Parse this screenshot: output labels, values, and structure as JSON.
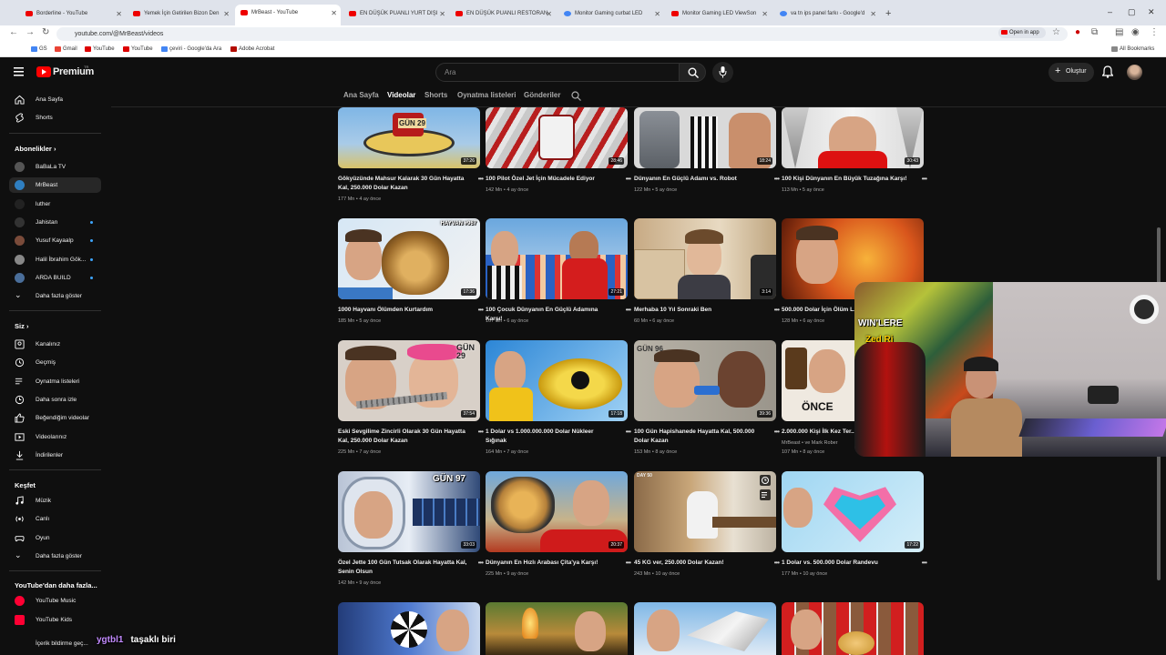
{
  "browser": {
    "tabs": [
      {
        "title": "Borderline - YouTube",
        "icon": "youtube-icon"
      },
      {
        "title": "Yemek İçin Getirilen Bizon Den",
        "icon": "youtube-icon"
      },
      {
        "title": "MrBeast - YouTube",
        "icon": "youtube-icon",
        "active": true
      },
      {
        "title": "EN DÜŞÜK PUANLI YURT DIŞI",
        "icon": "youtube-icon"
      },
      {
        "title": "EN DÜŞÜK PUANLI RESTORAN",
        "icon": "youtube-icon"
      },
      {
        "title": "Monitor Gaming curbat LED ",
        "icon": "google-icon"
      },
      {
        "title": "Monitor Gaming LED ViewSon",
        "icon": "youtube-icon"
      },
      {
        "title": "va tn ips panel farkı - Google'd",
        "icon": "google-icon"
      }
    ],
    "url": "youtube.com/@MrBeast/videos",
    "open_in_app": "Open in app",
    "bookmarks": [
      "Gmail",
      "YouTube",
      "YouTube",
      "çeviri - Google'da Ara",
      "Adobe Acrobat"
    ],
    "all_bookmarks": "All Bookmarks"
  },
  "youtube": {
    "logo": "Premium",
    "logo_sup": "TR",
    "search_placeholder": "Ara",
    "create_label": "Oluştur",
    "channel_tabs": [
      "Ana Sayfa",
      "Videolar",
      "Shorts",
      "Oynatma listeleri",
      "Gönderiler"
    ],
    "active_tab": "Videolar",
    "sidebar": {
      "top": [
        {
          "label": "Ana Sayfa",
          "icon": "home-icon"
        },
        {
          "label": "Shorts",
          "icon": "shorts-icon"
        }
      ],
      "subscriptions_header": "Abonelikler",
      "subscriptions": [
        {
          "label": "BaBaLa TV",
          "dot": false
        },
        {
          "label": "MrBeast",
          "dot": false,
          "active": true
        },
        {
          "label": "luther",
          "dot": false
        },
        {
          "label": "Jahistan",
          "dot": true
        },
        {
          "label": "Yusuf Kayaalp",
          "dot": true
        },
        {
          "label": "Halil İbrahim Gök...",
          "dot": true
        },
        {
          "label": "ARDA BUILD",
          "dot": true
        }
      ],
      "show_more": "Daha fazla göster",
      "you_header": "Siz",
      "you": [
        {
          "label": "Kanalınız",
          "icon": "channel-icon"
        },
        {
          "label": "Geçmiş",
          "icon": "history-icon"
        },
        {
          "label": "Oynatma listeleri",
          "icon": "playlists-icon"
        },
        {
          "label": "Daha sonra izle",
          "icon": "watch-later-icon"
        },
        {
          "label": "Beğendiğim videolar",
          "icon": "like-icon"
        },
        {
          "label": "Videolarınız",
          "icon": "your-videos-icon"
        },
        {
          "label": "İndirilenler",
          "icon": "download-icon"
        }
      ],
      "explore_header": "Keşfet",
      "explore": [
        {
          "label": "Müzik",
          "icon": "music-icon"
        },
        {
          "label": "Canlı",
          "icon": "live-icon"
        },
        {
          "label": "Oyun",
          "icon": "gaming-icon"
        }
      ],
      "show_more_2": "Daha fazla göster",
      "more_header": "YouTube'dan daha fazla...",
      "more": [
        {
          "label": "YouTube Music"
        },
        {
          "label": "YouTube Kids"
        }
      ],
      "footer_partial": "İçerik bildirme geç..."
    },
    "videos": [
      {
        "title": "Gökyüzünde Mahsur Kalarak 30 Gün Hayatta Kal, 250.000 Dolar Kazan",
        "meta": "177 Mn • 4 ay önce",
        "duration": "37:26",
        "overlay": "GÜN 29"
      },
      {
        "title": "100 Pilot Özel Jet İçin Mücadele Ediyor",
        "meta": "142 Mn • 4 ay önce",
        "duration": "28:46",
        "overlay": ""
      },
      {
        "title": "Dünyanın En Güçlü Adamı vs. Robot",
        "meta": "122 Mn • 5 ay önce",
        "duration": "18:24",
        "overlay": ""
      },
      {
        "title": "100 Kişi Dünyanın En Büyük Tuzağına Karşı!",
        "meta": "113 Mn • 5 ay önce",
        "duration": "30:43",
        "overlay": ""
      },
      {
        "title": "1000 Hayvanı Ölümden Kurtardım",
        "meta": "185 Mn • 5 ay önce",
        "duration": "17:36",
        "overlay": "HAYVAN #967"
      },
      {
        "title": "100 Çocuk Dünyanın En Güçlü Adamına Karşı!",
        "meta": "167 Mn • 6 ay önce",
        "duration": "27:21",
        "overlay": ""
      },
      {
        "title": "Merhaba 10 Yıl Sonraki Ben",
        "meta": "60 Mn • 6 ay önce",
        "duration": "3:14",
        "overlay": ""
      },
      {
        "title": "500.000 Dolar İçin Ölüm L...",
        "meta": "128 Mn • 6 ay önce",
        "duration": "",
        "overlay": ""
      },
      {
        "title": "Eski Sevgilime Zincirli Olarak 30 Gün Hayatta Kal, 250.000 Dolar Kazan",
        "meta": "225 Mn • 7 ay önce",
        "duration": "37:54",
        "overlay": "GÜN 29"
      },
      {
        "title": "1 Dolar vs 1.000.000.000 Dolar Nükleer Sığınak",
        "meta": "164 Mn • 7 ay önce",
        "duration": "17:18",
        "overlay": ""
      },
      {
        "title": "100 Gün Hapishanede Hayatta Kal, 500.000 Dolar Kazan",
        "meta": "153 Mn • 8 ay önce",
        "duration": "39:36",
        "overlay": "GÜN 96"
      },
      {
        "title": "2.000.000 Kişi İlk Kez Ter...",
        "meta": "107 Mn • 8 ay önce",
        "meta2": "MrBeast • ve Mark Rober",
        "duration": "",
        "overlay": "ÖNCE"
      },
      {
        "title": "Özel Jette 100 Gün Tutsak Olarak Hayatta Kal, Senin Olsun",
        "meta": "142 Mn • 9 ay önce",
        "duration": "33:03",
        "overlay": "GÜN 97"
      },
      {
        "title": "Dünyanın En Hızlı Arabası Çita'ya Karşı!",
        "meta": "225 Mn • 9 ay önce",
        "duration": "20:37",
        "overlay": ""
      },
      {
        "title": "45 KG ver, 250.000 Dolar Kazan!",
        "meta": "243 Mn • 10 ay önce",
        "duration": "",
        "overlay": "DAY 50"
      },
      {
        "title": "1 Dolar vs. 500.000 Dolar Randevu",
        "meta": "177 Mn • 10 ay önce",
        "duration": "17:22",
        "overlay": ""
      }
    ]
  },
  "webcam": {
    "overlay_text_1": "WIN'LERE",
    "overlay_text_2": "Zed Ri"
  },
  "chat": {
    "user": "ygtbl1",
    "message": "taşaklı biri"
  },
  "colors": {
    "accent": "#ff0000",
    "background": "#0f0f0f",
    "chat_user": "#c38bff"
  }
}
